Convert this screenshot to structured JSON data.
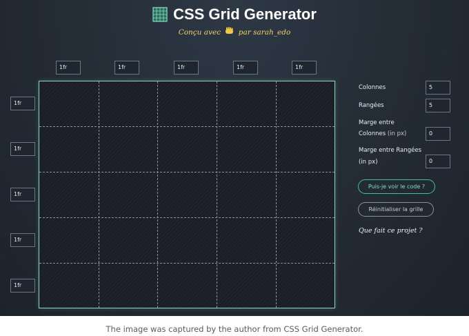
{
  "header": {
    "title": "CSS Grid Generator",
    "subtitle_prefix": "Conçu avec",
    "subtitle_suffix": "par sarah_edo",
    "hand_icon": "waving-hand-icon",
    "logo_icon": "grid-logo-icon"
  },
  "grid": {
    "columns": [
      "1fr",
      "1fr",
      "1fr",
      "1fr",
      "1fr"
    ],
    "rows": [
      "1fr",
      "1fr",
      "1fr",
      "1fr",
      "1fr"
    ]
  },
  "panel": {
    "columns_label": "Colonnes",
    "columns_value": "5",
    "rows_label": "Rangées",
    "rows_value": "5",
    "col_gap_label_line1": "Marge entre",
    "col_gap_label_line2": "Colonnes",
    "col_gap_unit": "(in px)",
    "col_gap_value": "0",
    "row_gap_label_line1": "Marge entre Rangées",
    "row_gap_unit": "(in px)",
    "row_gap_value": "0",
    "show_code_button": "Puis-je voir le code ?",
    "reset_button": "Réinitialiser la grille",
    "about_link": "Que fait ce projet ?"
  },
  "caption": "The image was captured by the author from CSS Grid Generator.",
  "colors": {
    "accent": "#3ec39a",
    "subtitle": "#f3d36b",
    "grid_border": "#8fd9c0"
  }
}
